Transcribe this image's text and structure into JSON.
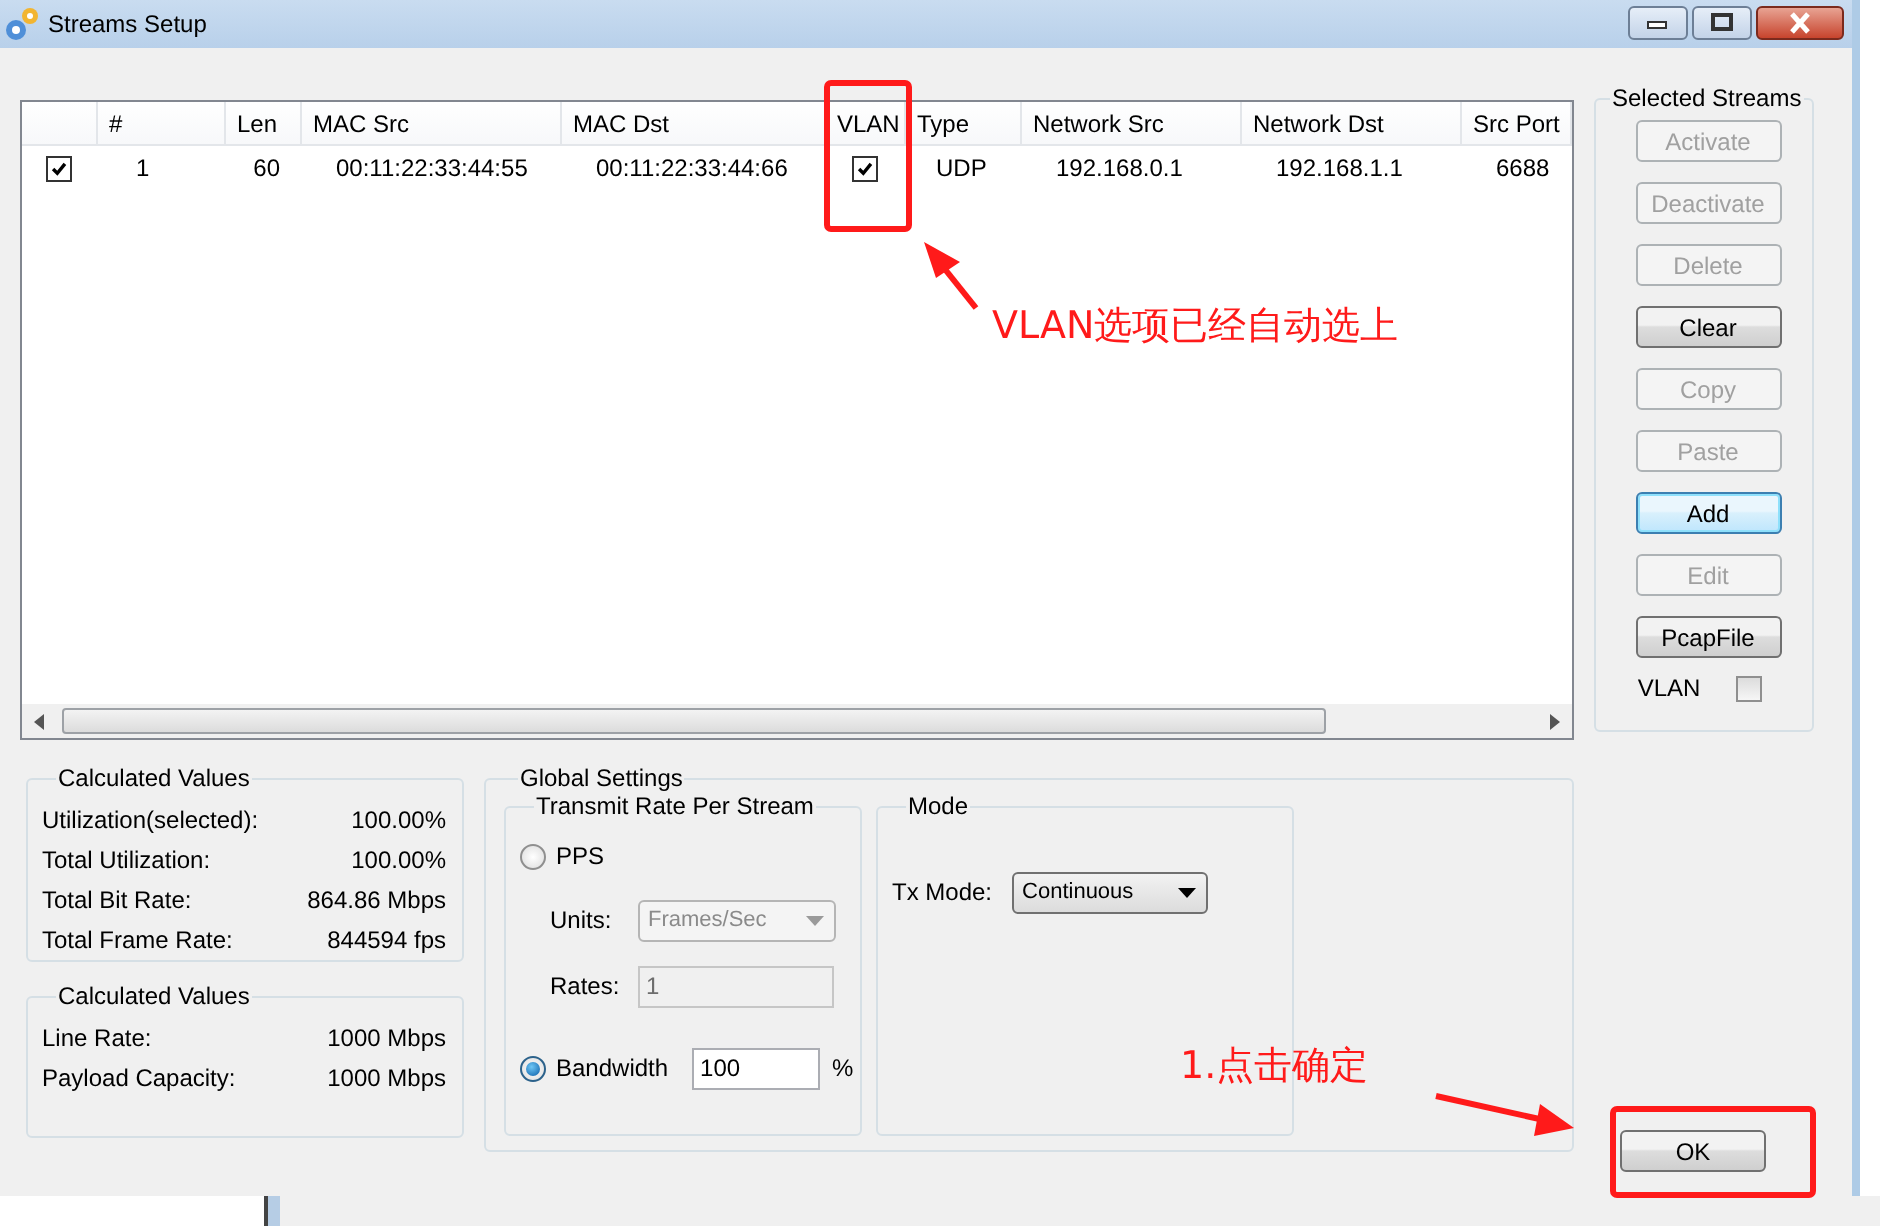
{
  "window": {
    "title": "Streams Setup"
  },
  "streams_table": {
    "columns": [
      "#",
      "Len",
      "MAC Src",
      "MAC Dst",
      "VLAN",
      "Type",
      "Network Src",
      "Network Dst",
      "Src Port"
    ],
    "rows": [
      {
        "checked": true,
        "cells": [
          {
            "kind": "text",
            "text": "1"
          },
          {
            "kind": "text",
            "text": "60"
          },
          {
            "kind": "text",
            "text": "00:11:22:33:44:55"
          },
          {
            "kind": "text",
            "text": "00:11:22:33:44:66"
          },
          {
            "kind": "check",
            "checked": true
          },
          {
            "kind": "text",
            "text": "UDP"
          },
          {
            "kind": "text",
            "text": "192.168.0.1"
          },
          {
            "kind": "text",
            "text": "192.168.1.1"
          },
          {
            "kind": "text",
            "text": "6688"
          }
        ]
      }
    ]
  },
  "selected_streams": {
    "title": "Selected Streams",
    "buttons": [
      {
        "label": "Activate",
        "disabled": true,
        "default": false
      },
      {
        "label": "Deactivate",
        "disabled": true,
        "default": false
      },
      {
        "label": "Delete",
        "disabled": true,
        "default": false
      },
      {
        "label": "Clear",
        "disabled": false,
        "default": false
      },
      {
        "label": "Copy",
        "disabled": true,
        "default": false
      },
      {
        "label": "Paste",
        "disabled": true,
        "default": false
      },
      {
        "label": "Add",
        "disabled": false,
        "default": true
      },
      {
        "label": "Edit",
        "disabled": true,
        "default": false
      },
      {
        "label": "PcapFile",
        "disabled": false,
        "default": false
      }
    ],
    "vlan": {
      "label": "VLAN",
      "checked": false
    }
  },
  "calculated_values": [
    {
      "title": "Calculated Values",
      "rows": [
        {
          "label": "Utilization(selected):",
          "value": "100.00%"
        },
        {
          "label": "Total Utilization:",
          "value": "100.00%"
        },
        {
          "label": "Total Bit Rate:",
          "value": "864.86 Mbps"
        },
        {
          "label": "Total Frame Rate:",
          "value": "844594 fps"
        }
      ]
    },
    {
      "title": "Calculated Values",
      "rows": [
        {
          "label": "Line Rate:",
          "value": "1000 Mbps"
        },
        {
          "label": "Payload Capacity:",
          "value": "1000 Mbps"
        }
      ]
    }
  ],
  "global_settings": {
    "title": "Global Settings",
    "transmit_rate": {
      "title": "Transmit Rate Per Stream",
      "pps": {
        "label": "PPS",
        "selected": false
      },
      "units": {
        "label": "Units:",
        "value": "Frames/Sec",
        "disabled": true
      },
      "rates": {
        "label": "Rates:",
        "value": "1",
        "disabled": true
      },
      "bandwidth": {
        "label": "Bandwidth",
        "selected": true,
        "value": "100",
        "unit": "%"
      }
    },
    "mode": {
      "title": "Mode",
      "tx_mode": {
        "label": "Tx Mode:",
        "value": "Continuous"
      }
    }
  },
  "ok_button": {
    "label": "OK"
  },
  "annotations": [
    {
      "text": "VLAN选项已经自动选上"
    },
    {
      "text": "1.点击确定"
    }
  ]
}
